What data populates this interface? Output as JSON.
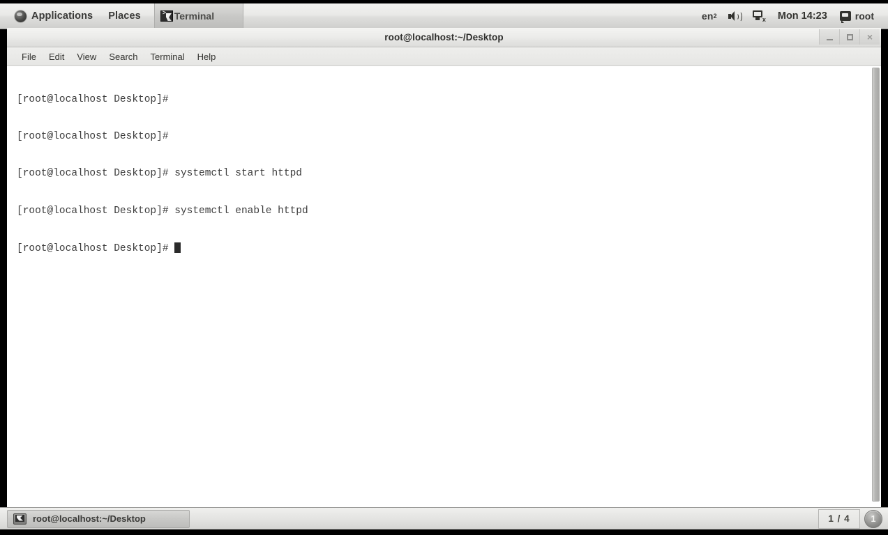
{
  "top_panel": {
    "applications_label": "Applications",
    "places_label": "Places",
    "window_button_label": "Terminal",
    "tray": {
      "keyboard_layout": "en",
      "keyboard_layout_sub": "2",
      "volume_icon": "speaker-icon",
      "network_icon": "network-disconnected-icon",
      "clock": "Mon 14:23",
      "user_icon": "user-chat-icon",
      "user_label": "root"
    }
  },
  "window": {
    "title": "root@localhost:~/Desktop",
    "controls": {
      "minimize": "minimize-icon",
      "maximize": "maximize-icon",
      "close": "×"
    },
    "menu": [
      {
        "label": "File"
      },
      {
        "label": "Edit"
      },
      {
        "label": "View"
      },
      {
        "label": "Search"
      },
      {
        "label": "Terminal"
      },
      {
        "label": "Help"
      }
    ],
    "terminal": {
      "lines": [
        "[root@localhost Desktop]#",
        "[root@localhost Desktop]#",
        "[root@localhost Desktop]# systemctl start httpd",
        "[root@localhost Desktop]# systemctl enable httpd"
      ],
      "prompt": "[root@localhost Desktop]# ",
      "cursor": "block"
    }
  },
  "bottom_panel": {
    "tasks": [
      {
        "label": "root@localhost:~/Desktop",
        "icon": "terminal-icon"
      }
    ],
    "workspace_label": "1 / 4",
    "workspace_badge": "1"
  },
  "colors": {
    "panel_bg": "#e6e6e4",
    "terminal_bg": "#ffffff",
    "terminal_fg": "#3c3c3c",
    "desktop_border": "#000000"
  }
}
